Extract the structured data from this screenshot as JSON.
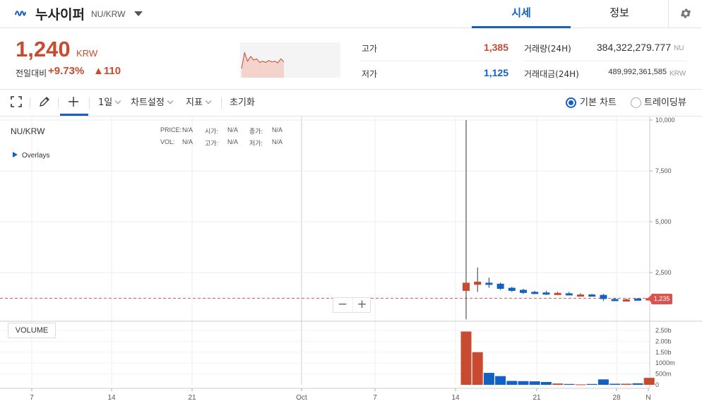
{
  "header": {
    "coin_name": "누사이퍼",
    "pair": "NU/KRW",
    "tabs": [
      {
        "label": "시세",
        "active": true
      },
      {
        "label": "정보",
        "active": false
      }
    ],
    "accent_color": "#1261c4"
  },
  "summary": {
    "price": "1,240",
    "price_unit": "KRW",
    "change_label": "전일대비",
    "change_rate": "+9.73%",
    "change_amount": "▲110",
    "up_color": "#c84a31",
    "down_color": "#1261c4",
    "high_label": "고가",
    "high_value": "1,385",
    "low_label": "저가",
    "low_value": "1,125",
    "volume_label": "거래량(24H)",
    "volume_value": "384,322,279.777",
    "volume_unit": "NU",
    "amount_label": "거래대금(24H)",
    "amount_value": "489,992,361,585",
    "amount_unit": "KRW"
  },
  "toolbar": {
    "interval": "1일",
    "chart_settings": "차트설정",
    "indicators": "지표",
    "reset": "초기화",
    "basic_chart": "기본 차트",
    "trading_view": "트레이딩뷰",
    "basic_chart_selected": true
  },
  "chart": {
    "pair": "NU/KRW",
    "overlays": "Overlays",
    "volume_label": "VOLUME",
    "last_price_tag": "1,235",
    "legend": [
      {
        "label": "PRICE:",
        "value": "N/A"
      },
      {
        "label": "시가:",
        "value": "N/A"
      },
      {
        "label": "종가:",
        "value": "N/A"
      },
      {
        "label": "VOL:",
        "value": "N/A"
      },
      {
        "label": "고가:",
        "value": "N/A"
      },
      {
        "label": "저가:",
        "value": "N/A"
      }
    ],
    "zoom_out": "−",
    "zoom_in": "+"
  },
  "chart_data": {
    "type": "candlestick",
    "price_axis": {
      "ticks": [
        "10,000",
        "7,500",
        "5,000",
        "2,500"
      ],
      "range": [
        0,
        10000
      ]
    },
    "volume_axis": {
      "ticks": [
        "2.50b",
        "2.00b",
        "1.50b",
        "1000m",
        "500m",
        "0"
      ],
      "range": [
        0,
        2700000000
      ]
    },
    "x_ticks": [
      "7",
      "14",
      "21",
      "Oct",
      "7",
      "14",
      "21",
      "28",
      "N"
    ],
    "last_price": 1235,
    "candles": [
      {
        "o": 1600,
        "h": 10000,
        "l": 200,
        "c": 2000,
        "up": true
      },
      {
        "o": 1900,
        "h": 2750,
        "l": 1550,
        "c": 2050,
        "up": true
      },
      {
        "o": 2000,
        "h": 2250,
        "l": 1750,
        "c": 1950,
        "up": false
      },
      {
        "o": 1950,
        "h": 2000,
        "l": 1650,
        "c": 1700,
        "up": false
      },
      {
        "o": 1750,
        "h": 1800,
        "l": 1550,
        "c": 1600,
        "up": false
      },
      {
        "o": 1650,
        "h": 1700,
        "l": 1450,
        "c": 1500,
        "up": false
      },
      {
        "o": 1550,
        "h": 1600,
        "l": 1450,
        "c": 1500,
        "up": false
      },
      {
        "o": 1520,
        "h": 1600,
        "l": 1400,
        "c": 1450,
        "up": false
      },
      {
        "o": 1450,
        "h": 1550,
        "l": 1400,
        "c": 1500,
        "up": true
      },
      {
        "o": 1480,
        "h": 1550,
        "l": 1400,
        "c": 1450,
        "up": false
      },
      {
        "o": 1400,
        "h": 1480,
        "l": 1350,
        "c": 1420,
        "up": true
      },
      {
        "o": 1420,
        "h": 1450,
        "l": 1320,
        "c": 1350,
        "up": false
      },
      {
        "o": 1400,
        "h": 1450,
        "l": 1100,
        "c": 1200,
        "up": false
      },
      {
        "o": 1200,
        "h": 1250,
        "l": 1100,
        "c": 1150,
        "up": false
      },
      {
        "o": 1150,
        "h": 1220,
        "l": 1100,
        "c": 1180,
        "up": true
      },
      {
        "o": 1220,
        "h": 1250,
        "l": 1130,
        "c": 1150,
        "up": false
      },
      {
        "o": 1150,
        "h": 1300,
        "l": 1125,
        "c": 1235,
        "up": true
      }
    ],
    "volumes": [
      2450000000,
      1500000000,
      550000000,
      400000000,
      180000000,
      170000000,
      160000000,
      130000000,
      60000000,
      40000000,
      20000000,
      40000000,
      250000000,
      50000000,
      50000000,
      70000000,
      320000000
    ],
    "spark": [
      0.85,
      0.2,
      0.55,
      0.35,
      0.5,
      0.45,
      0.6,
      0.55,
      0.6,
      0.52,
      0.58,
      0.55,
      0.62,
      0.45,
      0.58
    ]
  }
}
